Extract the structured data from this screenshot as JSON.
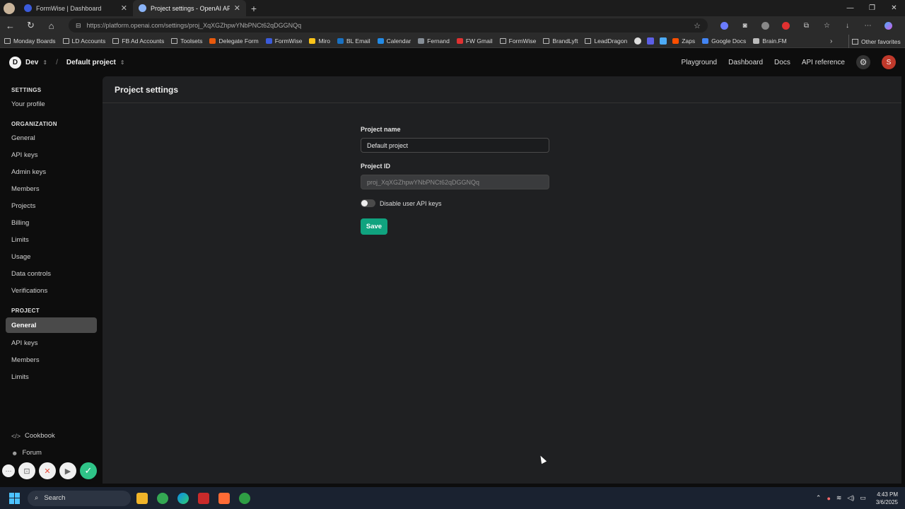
{
  "browser": {
    "tabs": [
      {
        "title": "FormWise | Dashboard",
        "favicon_color": "#3b5bdb",
        "active": false
      },
      {
        "title": "Project settings - OpenAI API",
        "favicon_color": "#8ab4f8",
        "active": true
      }
    ],
    "new_tab": "+",
    "url": "https://platform.openai.com/settings/proj_XqXGZhpwYNbPNCt62qDGGNQq",
    "bookmarks": [
      {
        "label": "Monday Boards"
      },
      {
        "label": "LD Accounts"
      },
      {
        "label": "FB Ad Accounts"
      },
      {
        "label": "Toolsets"
      },
      {
        "label": "Delegate Form"
      },
      {
        "label": "FormWise"
      },
      {
        "label": "Miro"
      },
      {
        "label": "BL Email"
      },
      {
        "label": "Calendar"
      },
      {
        "label": "Fernand"
      },
      {
        "label": "FW Gmail"
      },
      {
        "label": "FormWise"
      },
      {
        "label": "BrandLyft"
      },
      {
        "label": "LeadDragon"
      },
      {
        "label": "Zaps"
      },
      {
        "label": "Google Docs"
      },
      {
        "label": "Brain.FM"
      }
    ],
    "other_favorites": "Other favorites"
  },
  "app": {
    "workspace_initial": "D",
    "workspace": "Dev",
    "breadcrumb_sep": "/",
    "project": "Default project",
    "nav": [
      "Playground",
      "Dashboard",
      "Docs",
      "API reference"
    ],
    "user_initial": "S",
    "accent": "#10a37f"
  },
  "sidebar": {
    "settings_header": "SETTINGS",
    "settings_items": [
      "Your profile"
    ],
    "org_header": "ORGANIZATION",
    "org_items": [
      "General",
      "API keys",
      "Admin keys",
      "Members",
      "Projects",
      "Billing",
      "Limits",
      "Usage",
      "Data controls",
      "Verifications"
    ],
    "project_header": "PROJECT",
    "project_items": [
      "General",
      "API keys",
      "Members",
      "Limits"
    ],
    "footer": [
      {
        "label": "Cookbook",
        "icon": "code-icon"
      },
      {
        "label": "Forum",
        "icon": "people-icon"
      }
    ]
  },
  "main": {
    "title": "Project settings",
    "project_name_label": "Project name",
    "project_name_value": "Default project",
    "project_id_label": "Project ID",
    "project_id_value": "proj_XqXGZhpwYNbPNCt62qDGGNQq",
    "toggle_label": "Disable user API keys",
    "save_label": "Save"
  },
  "taskbar": {
    "search_label": "Search",
    "time": "4:43 PM",
    "date": "3/6/2025"
  }
}
